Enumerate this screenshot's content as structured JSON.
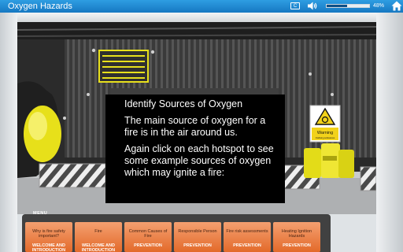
{
  "header": {
    "title": "Oxygen Hazards",
    "cc_label": "C",
    "volume_icon": "speaker-icon",
    "home_icon": "home-icon",
    "progress_percent": 48,
    "progress_text": "48%"
  },
  "scene": {
    "warning_sign": {
      "label": "Warning",
      "sublabel": "Oxidising substances",
      "icon": "flame-over-circle-icon"
    }
  },
  "info_panel": {
    "heading": "Identify Sources of Oxygen",
    "paragraphs": [
      "The main source of oxygen for a fire is in the air around us.",
      "Again click on each hotspot to see some example sources of oxygen which may ignite a fire:"
    ]
  },
  "menu": {
    "label": "MENU",
    "cards": [
      {
        "title": "Why is fire safety important?",
        "section": "WELCOME AND INTRODUCTION"
      },
      {
        "title": "Fire",
        "section": "WELCOME AND INTRODUCTION"
      },
      {
        "title": "Common Causes of Fire",
        "section": "PREVENTION"
      },
      {
        "title": "Responsible Person",
        "section": "PREVENTION"
      },
      {
        "title": "Fire risk assessments",
        "section": "PREVENTION"
      },
      {
        "title": "Heating Ignition Hazards",
        "section": "PREVENTION"
      }
    ]
  },
  "colors": {
    "header_bar": "#1c86d2",
    "card_orange": "#e8763a",
    "sign_yellow": "#f2d21a",
    "highlight_yellow": "#e8e01c"
  }
}
